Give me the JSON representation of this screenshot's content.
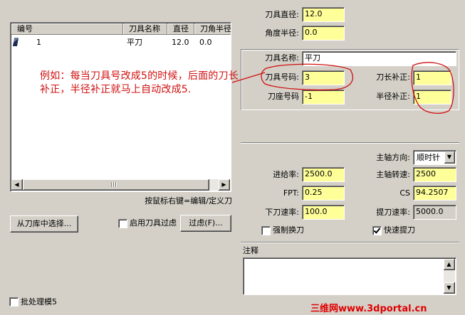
{
  "colors": {
    "dialog_bg": "#d4d0c8",
    "editable_field": "#ffff99",
    "annotation": "#d01010",
    "watermark": "#e00000"
  },
  "tool_list": {
    "columns": [
      "编号",
      "刀具名称",
      "直径",
      "刀角半径"
    ],
    "rows": [
      {
        "number": "1",
        "name": "平刀",
        "diameter": "12.0",
        "corner_radius": "0.0"
      }
    ],
    "hint": "按鼠标右键=编辑/定义刀"
  },
  "buttons": {
    "select_from_library": "从刀库中选择...",
    "filter": "过虑(F)..."
  },
  "checkboxes": {
    "enable_tool_filter": {
      "label": "启用刀具过虑",
      "checked": false
    },
    "batch_mode": {
      "label": "批处理模5",
      "checked": false
    },
    "force_tool_change": {
      "label": "强制换刀",
      "checked": false
    },
    "rapid_retract": {
      "label": "快速提刀",
      "checked": true
    }
  },
  "tool_params": {
    "diameter_label": "刀具直径:",
    "diameter": "12.0",
    "corner_radius_label": "角度半径:",
    "corner_radius": "0.0",
    "tool_name_label": "刀具名称:",
    "tool_name": "平刀",
    "tool_number_label": "刀具号码:",
    "tool_number": "3",
    "length_offset_label": "刀长补正:",
    "length_offset": "1",
    "holder_number_label": "刀座号码",
    "holder_number": "-1",
    "radius_offset_label": "半径补正:",
    "radius_offset": "1"
  },
  "spindle": {
    "direction_label": "主轴方向:",
    "direction": "顺时针",
    "feed_rate_label": "进给率:",
    "feed_rate": "2500.0",
    "spindle_speed_label": "主轴转速:",
    "spindle_speed": "2500",
    "fpt_label": "FPT:",
    "fpt": "0.25",
    "cs_label": "CS",
    "cs": "94.2507",
    "plunge_rate_label": "下刀速率:",
    "plunge_rate": "100.0",
    "retract_rate_label": "提刀速率:",
    "retract_rate": "5000.0"
  },
  "comment": {
    "label": "注释",
    "text": ""
  },
  "annotation": "例如：每当刀具号改成5的时候，后面的刀长补正，半径补正就马上自动改成5.",
  "watermark": "三维网www.3dportal.cn"
}
